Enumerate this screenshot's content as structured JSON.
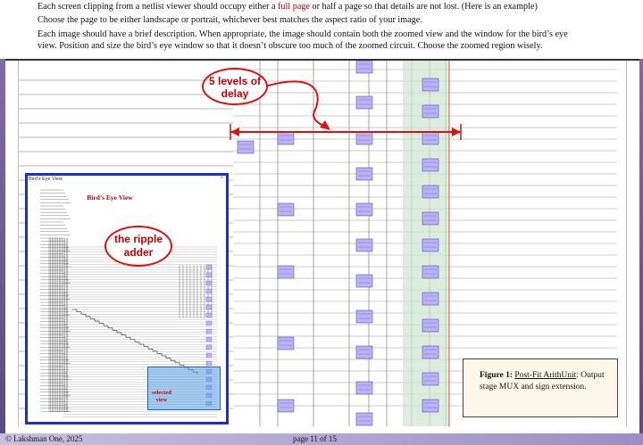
{
  "header": {
    "line1_pre": "Each screen clipping from a netlist viewer should occupy either a ",
    "line1_link": "full page",
    "line1_post": " or half a page so that details are not lost. (Here is an example)",
    "line2": "Choose the page to be either landscape or portrait, whichever best matches the aspect ratio of your image.",
    "line3": "Each image should have a brief description. When appropriate, the image should contain both the zoomed view and the window for the bird’s eye",
    "line4": "view. Position and size the bird’s eye window so that it doesn’t obscure too much of the zoomed circuit. Choose the zoomed region wisely."
  },
  "viewer": {
    "callout_delay": "5 levels of delay",
    "birdseye": {
      "title": "Bird's Eye View",
      "close_glyph": "×",
      "label": "Bird’s Eye View",
      "callout_ripple": "the ripple adder",
      "selected_label": "selected view"
    }
  },
  "caption": {
    "title": "Figure 1:",
    "name": "Post-Fit ArithUnit",
    "text": ": Output stage MUX and sign extension."
  },
  "footer": {
    "copyright": "© Lakshman One, 2025",
    "page": "page 11 of 15"
  },
  "colors": {
    "accent_red": "#c00000",
    "birdseye_border": "#1a2fd0",
    "gate_fill": "#b9b2f4",
    "strip": "#6b5a98"
  }
}
